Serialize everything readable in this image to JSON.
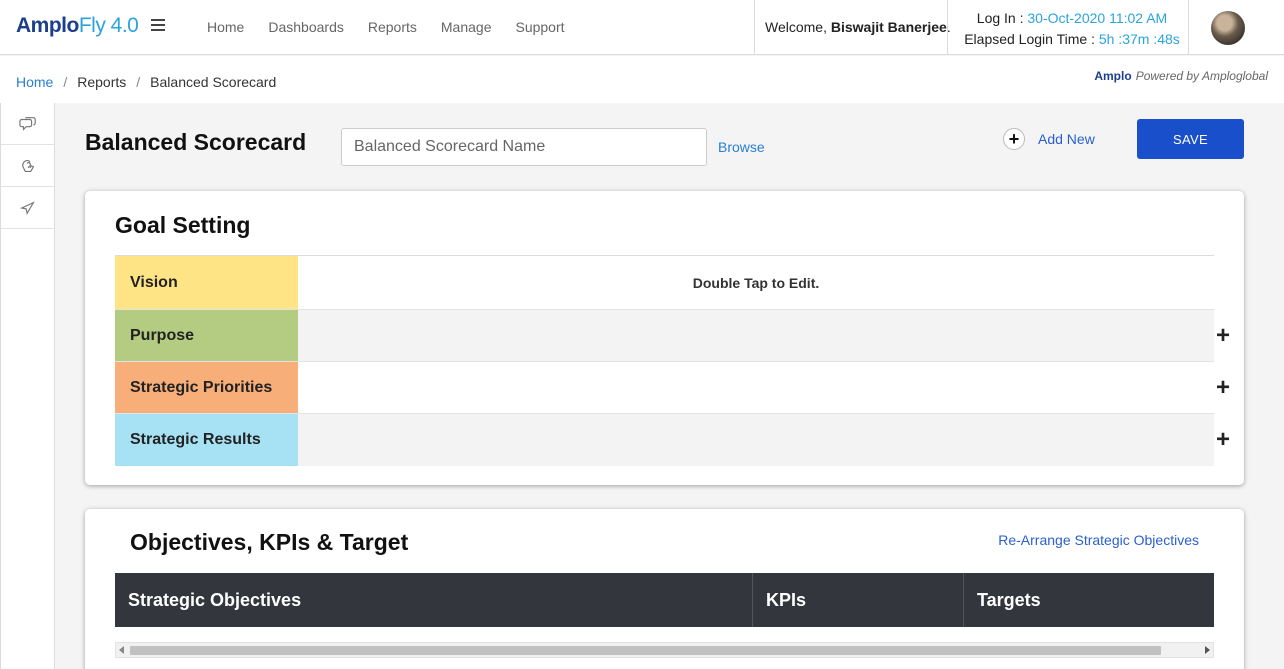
{
  "header": {
    "logo_main": "Amplo",
    "logo_fly": "Fly 4.0",
    "nav": [
      "Home",
      "Dashboards",
      "Reports",
      "Manage",
      "Support"
    ],
    "welcome_prefix": "Welcome, ",
    "user_name": "Biswajit Banerjee",
    "welcome_suffix": ".",
    "login_label": "Log In : ",
    "login_value": "30-Oct-2020 11:02 AM",
    "elapsed_label": "Elapsed Login Time : ",
    "elapsed_value": "5h :37m :48s"
  },
  "breadcrumb": [
    "Home",
    "Reports",
    "Balanced Scorecard"
  ],
  "powered": {
    "brand": "Amplo",
    "text": "Powered by Amploglobal"
  },
  "rail": {
    "icons": [
      "chat-bubbles-icon",
      "hand-heart-icon",
      "send-icon"
    ]
  },
  "toolbar": {
    "title": "Balanced Scorecard",
    "name_placeholder": "Balanced Scorecard Name",
    "browse": "Browse",
    "add_new": "Add New",
    "add_symbol": "+",
    "save": "SAVE"
  },
  "goal_setting": {
    "title": "Goal Setting",
    "rows": [
      {
        "label": "Vision",
        "color": "#ffe486",
        "content": "Double Tap to Edit."
      },
      {
        "label": "Purpose",
        "color": "#b4cc82",
        "content": ""
      },
      {
        "label": "Strategic Priorities",
        "color": "#f7ae78",
        "content": ""
      },
      {
        "label": "Strategic Results",
        "color": "#a7e2f4",
        "content": ""
      }
    ],
    "add_symbol": "+"
  },
  "objectives": {
    "title": "Objectives, KPIs & Target",
    "rearrange": "Re-Arrange Strategic Objectives",
    "columns": [
      "Strategic Objectives",
      "KPIs",
      "Targets"
    ]
  },
  "colors": {
    "accent": "#1a4fcc",
    "link": "#2a7fd0",
    "header_dark": "#33363c"
  }
}
